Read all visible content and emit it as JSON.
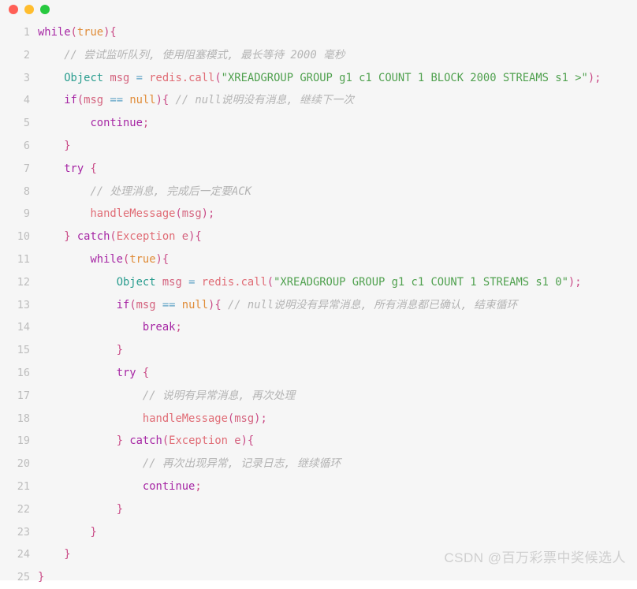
{
  "window": {
    "controls": [
      {
        "name": "close",
        "color": "#ff5f56"
      },
      {
        "name": "minimize",
        "color": "#ffbd2e"
      },
      {
        "name": "maximize",
        "color": "#27c93f"
      }
    ],
    "background": "#f6f6f6"
  },
  "watermark": "CSDN @百万彩票中奖候选人",
  "editor": {
    "language": "java",
    "line_count": 25,
    "lines": [
      {
        "n": "1",
        "indent": 0,
        "tokens": [
          {
            "t": "while",
            "c": "kw"
          },
          {
            "t": "(",
            "c": "punc"
          },
          {
            "t": "true",
            "c": "lit"
          },
          {
            "t": ")",
            "c": "punc"
          },
          {
            "t": "{",
            "c": "punc"
          }
        ]
      },
      {
        "n": "2",
        "indent": 1,
        "tokens": [
          {
            "t": "// 尝试监听队列, 使用阻塞模式, 最长等待 2000 毫秒",
            "c": "cmt"
          }
        ]
      },
      {
        "n": "3",
        "indent": 1,
        "tokens": [
          {
            "t": "Object",
            "c": "type"
          },
          {
            "t": " ",
            "c": "plain"
          },
          {
            "t": "msg",
            "c": "var"
          },
          {
            "t": " ",
            "c": "plain"
          },
          {
            "t": "=",
            "c": "op"
          },
          {
            "t": " ",
            "c": "plain"
          },
          {
            "t": "redis",
            "c": "fn"
          },
          {
            "t": ".",
            "c": "fn"
          },
          {
            "t": "call",
            "c": "fn"
          },
          {
            "t": "(",
            "c": "punc"
          },
          {
            "t": "\"XREADGROUP GROUP g1 c1 COUNT 1 BLOCK 2000 STREAMS s1 >\"",
            "c": "str"
          },
          {
            "t": ")",
            "c": "punc"
          },
          {
            "t": ";",
            "c": "punc"
          }
        ]
      },
      {
        "n": "4",
        "indent": 1,
        "tokens": [
          {
            "t": "if",
            "c": "kw"
          },
          {
            "t": "(",
            "c": "punc"
          },
          {
            "t": "msg",
            "c": "var"
          },
          {
            "t": " ",
            "c": "plain"
          },
          {
            "t": "==",
            "c": "op"
          },
          {
            "t": " ",
            "c": "plain"
          },
          {
            "t": "null",
            "c": "null"
          },
          {
            "t": ")",
            "c": "punc"
          },
          {
            "t": "{",
            "c": "punc"
          },
          {
            "t": " ",
            "c": "plain"
          },
          {
            "t": "// null说明没有消息, 继续下一次",
            "c": "cmt"
          }
        ]
      },
      {
        "n": "5",
        "indent": 2,
        "tokens": [
          {
            "t": "continue",
            "c": "kw"
          },
          {
            "t": ";",
            "c": "punc"
          }
        ]
      },
      {
        "n": "6",
        "indent": 1,
        "tokens": [
          {
            "t": "}",
            "c": "punc"
          }
        ]
      },
      {
        "n": "7",
        "indent": 1,
        "tokens": [
          {
            "t": "try",
            "c": "kw"
          },
          {
            "t": " ",
            "c": "plain"
          },
          {
            "t": "{",
            "c": "punc"
          }
        ]
      },
      {
        "n": "8",
        "indent": 2,
        "tokens": [
          {
            "t": "// 处理消息, 完成后一定要ACK",
            "c": "cmt"
          }
        ]
      },
      {
        "n": "9",
        "indent": 2,
        "tokens": [
          {
            "t": "handleMessage",
            "c": "fn"
          },
          {
            "t": "(",
            "c": "punc"
          },
          {
            "t": "msg",
            "c": "var"
          },
          {
            "t": ")",
            "c": "punc"
          },
          {
            "t": ";",
            "c": "punc"
          }
        ]
      },
      {
        "n": "10",
        "indent": 1,
        "tokens": [
          {
            "t": "}",
            "c": "punc"
          },
          {
            "t": " ",
            "c": "plain"
          },
          {
            "t": "catch",
            "c": "kw"
          },
          {
            "t": "(",
            "c": "punc"
          },
          {
            "t": "Exception",
            "c": "fn"
          },
          {
            "t": " ",
            "c": "plain"
          },
          {
            "t": "e",
            "c": "var"
          },
          {
            "t": ")",
            "c": "punc"
          },
          {
            "t": "{",
            "c": "punc"
          }
        ]
      },
      {
        "n": "11",
        "indent": 2,
        "tokens": [
          {
            "t": "while",
            "c": "kw"
          },
          {
            "t": "(",
            "c": "punc"
          },
          {
            "t": "true",
            "c": "lit"
          },
          {
            "t": ")",
            "c": "punc"
          },
          {
            "t": "{",
            "c": "punc"
          }
        ]
      },
      {
        "n": "12",
        "indent": 3,
        "tokens": [
          {
            "t": "Object",
            "c": "type"
          },
          {
            "t": " ",
            "c": "plain"
          },
          {
            "t": "msg",
            "c": "var"
          },
          {
            "t": " ",
            "c": "plain"
          },
          {
            "t": "=",
            "c": "op"
          },
          {
            "t": " ",
            "c": "plain"
          },
          {
            "t": "redis",
            "c": "fn"
          },
          {
            "t": ".",
            "c": "fn"
          },
          {
            "t": "call",
            "c": "fn"
          },
          {
            "t": "(",
            "c": "punc"
          },
          {
            "t": "\"XREADGROUP GROUP g1 c1 COUNT 1 STREAMS s1 0\"",
            "c": "str"
          },
          {
            "t": ")",
            "c": "punc"
          },
          {
            "t": ";",
            "c": "punc"
          }
        ]
      },
      {
        "n": "13",
        "indent": 3,
        "tokens": [
          {
            "t": "if",
            "c": "kw"
          },
          {
            "t": "(",
            "c": "punc"
          },
          {
            "t": "msg",
            "c": "var"
          },
          {
            "t": " ",
            "c": "plain"
          },
          {
            "t": "==",
            "c": "op"
          },
          {
            "t": " ",
            "c": "plain"
          },
          {
            "t": "null",
            "c": "null"
          },
          {
            "t": ")",
            "c": "punc"
          },
          {
            "t": "{",
            "c": "punc"
          },
          {
            "t": " ",
            "c": "plain"
          },
          {
            "t": "// null说明没有异常消息, 所有消息都已确认, 结束循环",
            "c": "cmt"
          }
        ]
      },
      {
        "n": "14",
        "indent": 4,
        "tokens": [
          {
            "t": "break",
            "c": "kw"
          },
          {
            "t": ";",
            "c": "punc"
          }
        ]
      },
      {
        "n": "15",
        "indent": 3,
        "tokens": [
          {
            "t": "}",
            "c": "punc"
          }
        ]
      },
      {
        "n": "16",
        "indent": 3,
        "tokens": [
          {
            "t": "try",
            "c": "kw"
          },
          {
            "t": " ",
            "c": "plain"
          },
          {
            "t": "{",
            "c": "punc"
          }
        ]
      },
      {
        "n": "17",
        "indent": 4,
        "tokens": [
          {
            "t": "// 说明有异常消息, 再次处理",
            "c": "cmt"
          }
        ]
      },
      {
        "n": "18",
        "indent": 4,
        "tokens": [
          {
            "t": "handleMessage",
            "c": "fn"
          },
          {
            "t": "(",
            "c": "punc"
          },
          {
            "t": "msg",
            "c": "var"
          },
          {
            "t": ")",
            "c": "punc"
          },
          {
            "t": ";",
            "c": "punc"
          }
        ]
      },
      {
        "n": "19",
        "indent": 3,
        "tokens": [
          {
            "t": "}",
            "c": "punc"
          },
          {
            "t": " ",
            "c": "plain"
          },
          {
            "t": "catch",
            "c": "kw"
          },
          {
            "t": "(",
            "c": "punc"
          },
          {
            "t": "Exception",
            "c": "fn"
          },
          {
            "t": " ",
            "c": "plain"
          },
          {
            "t": "e",
            "c": "var"
          },
          {
            "t": ")",
            "c": "punc"
          },
          {
            "t": "{",
            "c": "punc"
          }
        ]
      },
      {
        "n": "20",
        "indent": 4,
        "tokens": [
          {
            "t": "// 再次出现异常, 记录日志, 继续循环",
            "c": "cmt"
          }
        ]
      },
      {
        "n": "21",
        "indent": 4,
        "tokens": [
          {
            "t": "continue",
            "c": "kw"
          },
          {
            "t": ";",
            "c": "punc"
          }
        ]
      },
      {
        "n": "22",
        "indent": 3,
        "tokens": [
          {
            "t": "}",
            "c": "punc"
          }
        ]
      },
      {
        "n": "23",
        "indent": 2,
        "tokens": [
          {
            "t": "}",
            "c": "punc"
          }
        ]
      },
      {
        "n": "24",
        "indent": 1,
        "tokens": [
          {
            "t": "}",
            "c": "punc"
          }
        ]
      },
      {
        "n": "25",
        "indent": 0,
        "tokens": [
          {
            "t": "}",
            "c": "punc"
          }
        ]
      }
    ]
  }
}
